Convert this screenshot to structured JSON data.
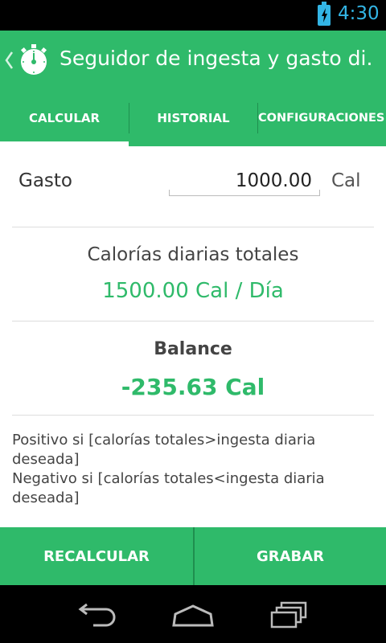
{
  "status_bar": {
    "time": "4:30",
    "icons": [
      "battery-charging-icon"
    ]
  },
  "action_bar": {
    "title": "Seguidor de ingesta y gasto di.",
    "icons": [
      "up-chevron-icon",
      "stopwatch-icon"
    ]
  },
  "tabs": [
    {
      "label": "CALCULAR",
      "selected": true
    },
    {
      "label": "HISTORIAL",
      "selected": false
    },
    {
      "label": "CONFIGURACIONES",
      "selected": false
    }
  ],
  "gasto": {
    "label": "Gasto",
    "value": "1000.00",
    "unit": "Cal"
  },
  "totales": {
    "label": "Calorías diarias totales",
    "value": "1500.00 Cal / Día"
  },
  "balance": {
    "label": "Balance",
    "value": "-235.63 Cal"
  },
  "notes": {
    "positivo": "Positivo si [calorías totales>ingesta diaria deseada]",
    "negativo": "Negativo si [calorías totales<ingesta diaria deseada]"
  },
  "buttons": {
    "recalcular": "RECALCULAR",
    "grabar": "GRABAR"
  },
  "nav_bar": {
    "icons": [
      "back-icon",
      "home-icon",
      "recent-apps-icon"
    ]
  },
  "colors": {
    "accent": "#2fba6a",
    "accent_dark": "#1f8f4f",
    "status_text": "#33b5e5"
  }
}
